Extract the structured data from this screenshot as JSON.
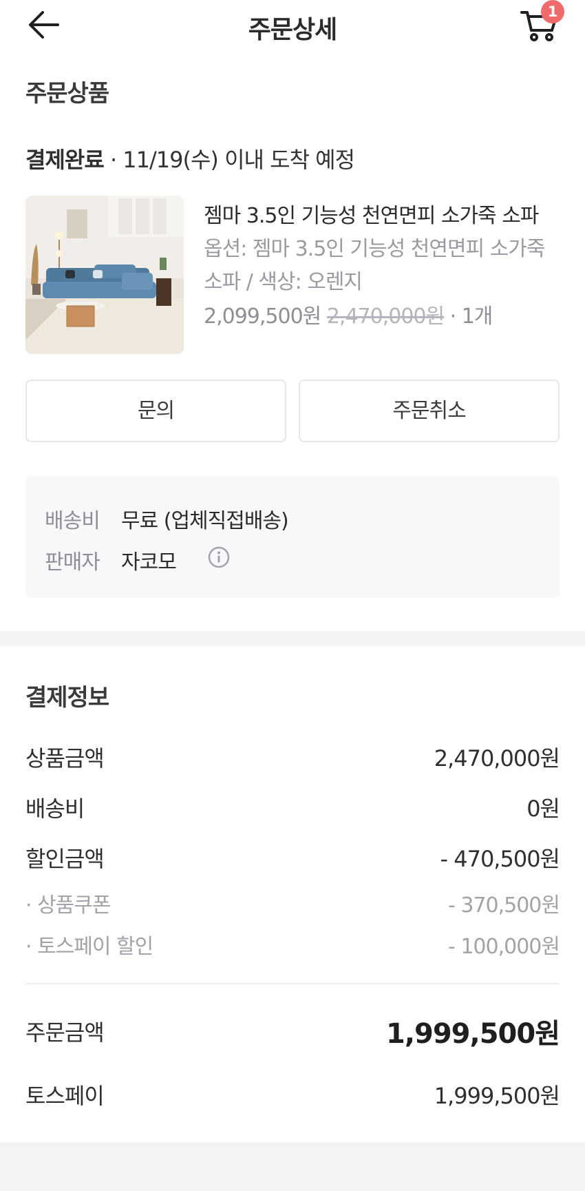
{
  "header": {
    "title": "주문상세",
    "cart_count": "1",
    "icons": {
      "back": "arrow-left-icon",
      "cart": "cart-icon"
    }
  },
  "order_items": {
    "section_title": "주문상품",
    "status": "결제완료",
    "status_detail": " · 11/19(수) 이내 도착 예정",
    "product": {
      "name": "젬마 3.5인 기능성 천연면피 소가죽 소파",
      "option": "옵션: 젬마 3.5인 기능성 천연면피 소가죽 소파 / 색상: 오렌지",
      "price": "2,099,500원",
      "original_price": "2,470,000원",
      "quantity": " · 1개"
    },
    "buttons": {
      "inquiry": "문의",
      "cancel": "주문취소"
    },
    "info": {
      "shipping_label": "배송비",
      "shipping_value": "무료 (업체직접배송)",
      "seller_label": "판매자",
      "seller_value": "자코모"
    }
  },
  "payment": {
    "section_title": "결제정보",
    "product_amount_label": "상품금액",
    "product_amount": "2,470,000원",
    "shipping_label": "배송비",
    "shipping_amount": "0원",
    "discount_label": "할인금액",
    "discount_amount": "- 470,500원",
    "coupon_label": "· 상품쿠폰",
    "coupon_amount": "- 370,500원",
    "tosspay_discount_label": "· 토스페이 할인",
    "tosspay_discount_amount": "- 100,000원",
    "order_total_label": "주문금액",
    "order_total": "1,999,500원",
    "method_label": "토스페이",
    "method_amount": "1,999,500원"
  },
  "colors": {
    "badge": "#ef6b6b",
    "box_bg": "#f8f8fa",
    "muted_text": "#8e8e95"
  }
}
